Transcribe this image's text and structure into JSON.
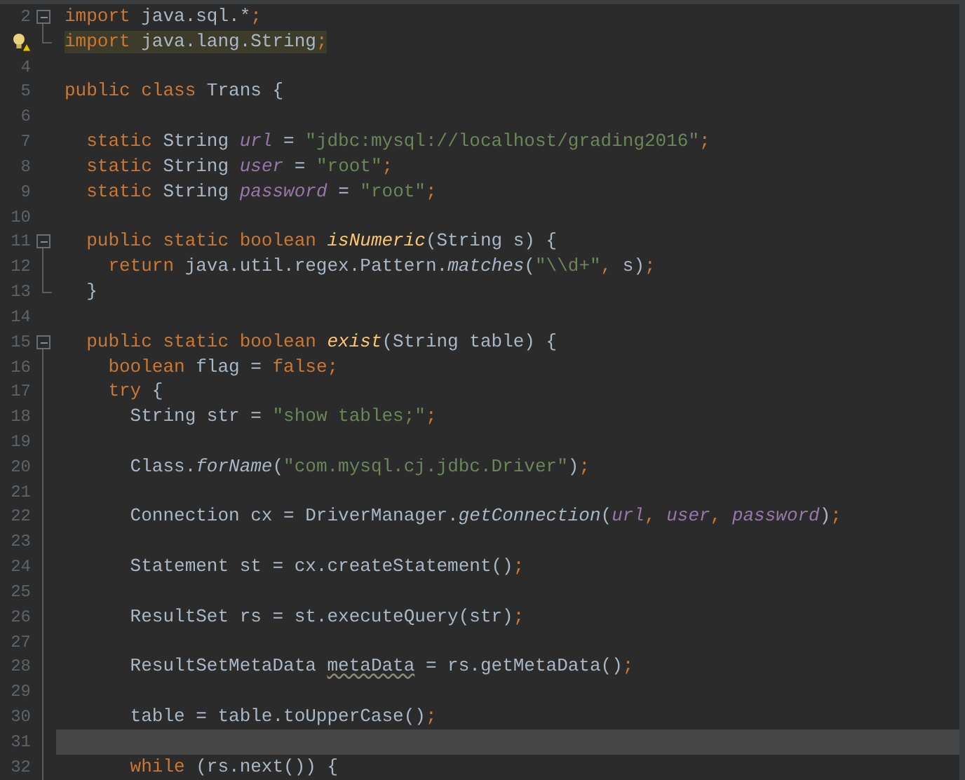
{
  "lines": [
    {
      "number": "2",
      "fold_marker": {
        "kind": "start"
      },
      "current": false,
      "warning": false,
      "tokens": [
        {
          "text": "import",
          "kind": "kw"
        },
        {
          "text": " java.sql.*",
          "kind": "plain"
        },
        {
          "text": ";",
          "kind": "punct"
        }
      ]
    },
    {
      "fold_marker": {
        "kind": "end"
      },
      "current": false,
      "warning": true,
      "tokens": [
        {
          "text": "import",
          "kind": "kw"
        },
        {
          "text": " java.lang.String",
          "kind": "plain"
        },
        {
          "text": ";",
          "kind": "punct"
        }
      ]
    },
    {
      "number": "4",
      "current": false,
      "warning": false
    },
    {
      "number": "5",
      "current": false,
      "warning": false,
      "tokens": [
        {
          "text": "public class",
          "kind": "kw"
        },
        {
          "text": " Trans {",
          "kind": "plain"
        }
      ]
    },
    {
      "number": "6",
      "current": false,
      "warning": false
    },
    {
      "number": "7",
      "current": false,
      "warning": false,
      "tokens": [
        {
          "text": "  static",
          "kind": "kw"
        },
        {
          "text": " String ",
          "kind": "plain"
        },
        {
          "text": "url",
          "kind": "field"
        },
        {
          "text": " = ",
          "kind": "plain"
        },
        {
          "text": "\"jdbc:mysql://localhost/grading2016\"",
          "kind": "str"
        },
        {
          "text": ";",
          "kind": "punct"
        }
      ]
    },
    {
      "number": "8",
      "current": false,
      "warning": false,
      "tokens": [
        {
          "text": "  static",
          "kind": "kw"
        },
        {
          "text": " String ",
          "kind": "plain"
        },
        {
          "text": "user",
          "kind": "field"
        },
        {
          "text": " = ",
          "kind": "plain"
        },
        {
          "text": "\"root\"",
          "kind": "str"
        },
        {
          "text": ";",
          "kind": "punct"
        }
      ]
    },
    {
      "number": "9",
      "current": false,
      "warning": false,
      "tokens": [
        {
          "text": "  static",
          "kind": "kw"
        },
        {
          "text": " String ",
          "kind": "plain"
        },
        {
          "text": "password",
          "kind": "field"
        },
        {
          "text": " = ",
          "kind": "plain"
        },
        {
          "text": "\"root\"",
          "kind": "str"
        },
        {
          "text": ";",
          "kind": "punct"
        }
      ]
    },
    {
      "number": "10",
      "current": false,
      "warning": false
    },
    {
      "number": "11",
      "fold_marker": {
        "kind": "start"
      },
      "current": false,
      "warning": false,
      "tokens": [
        {
          "text": "  public static boolean",
          "kind": "kw"
        },
        {
          "text": " isNumeric",
          "kind": "method"
        },
        {
          "text": "(String s) {",
          "kind": "plain"
        }
      ]
    },
    {
      "number": "12",
      "fold_marker": {
        "kind": "line"
      },
      "current": false,
      "warning": false,
      "tokens": [
        {
          "text": "    return",
          "kind": "kw"
        },
        {
          "text": " java.util.regex.Pattern.",
          "kind": "plain"
        },
        {
          "text": "matches",
          "kind": "call"
        },
        {
          "text": "(",
          "kind": "plain"
        },
        {
          "text": "\"\\\\d+\"",
          "kind": "str"
        },
        {
          "text": ", ",
          "kind": "punct"
        },
        {
          "text": "s)",
          "kind": "plain"
        },
        {
          "text": ";",
          "kind": "punct"
        }
      ]
    },
    {
      "number": "13",
      "fold_marker": {
        "kind": "end"
      },
      "current": false,
      "warning": false,
      "tokens": [
        {
          "text": "  }",
          "kind": "plain"
        }
      ]
    },
    {
      "number": "14",
      "current": false,
      "warning": false
    },
    {
      "number": "15",
      "fold_marker": {
        "kind": "start"
      },
      "current": false,
      "warning": false,
      "tokens": [
        {
          "text": "  public static boolean",
          "kind": "kw"
        },
        {
          "text": " exist",
          "kind": "method"
        },
        {
          "text": "(String table) {",
          "kind": "plain"
        }
      ]
    },
    {
      "number": "16",
      "fold_marker": {
        "kind": "line"
      },
      "current": false,
      "warning": false,
      "tokens": [
        {
          "text": "    boolean",
          "kind": "kw"
        },
        {
          "text": " flag = ",
          "kind": "plain"
        },
        {
          "text": "false",
          "kind": "kw"
        },
        {
          "text": ";",
          "kind": "punct"
        }
      ]
    },
    {
      "number": "17",
      "fold_marker": {
        "kind": "line"
      },
      "current": false,
      "warning": false,
      "tokens": [
        {
          "text": "    try",
          "kind": "kw"
        },
        {
          "text": " {",
          "kind": "plain"
        }
      ]
    },
    {
      "number": "18",
      "fold_marker": {
        "kind": "line"
      },
      "current": false,
      "warning": false,
      "tokens": [
        {
          "text": "      String str = ",
          "kind": "plain"
        },
        {
          "text": "\"show tables;\"",
          "kind": "str"
        },
        {
          "text": ";",
          "kind": "punct"
        }
      ]
    },
    {
      "number": "19",
      "fold_marker": {
        "kind": "line"
      },
      "current": false,
      "warning": false
    },
    {
      "number": "20",
      "fold_marker": {
        "kind": "line"
      },
      "current": false,
      "warning": false,
      "tokens": [
        {
          "text": "      Class.",
          "kind": "plain"
        },
        {
          "text": "forName",
          "kind": "call"
        },
        {
          "text": "(",
          "kind": "plain"
        },
        {
          "text": "\"com.mysql.cj.jdbc.Driver\"",
          "kind": "str"
        },
        {
          "text": ")",
          "kind": "plain"
        },
        {
          "text": ";",
          "kind": "punct"
        }
      ]
    },
    {
      "number": "21",
      "fold_marker": {
        "kind": "line"
      },
      "current": false,
      "warning": false
    },
    {
      "number": "22",
      "fold_marker": {
        "kind": "line"
      },
      "current": false,
      "warning": false,
      "tokens": [
        {
          "text": "      Connection cx = DriverManager.",
          "kind": "plain"
        },
        {
          "text": "getConnection",
          "kind": "call"
        },
        {
          "text": "(",
          "kind": "plain"
        },
        {
          "text": "url",
          "kind": "field"
        },
        {
          "text": ", ",
          "kind": "punct"
        },
        {
          "text": "user",
          "kind": "field"
        },
        {
          "text": ", ",
          "kind": "punct"
        },
        {
          "text": "password",
          "kind": "field"
        },
        {
          "text": ")",
          "kind": "plain"
        },
        {
          "text": ";",
          "kind": "punct"
        }
      ]
    },
    {
      "number": "23",
      "fold_marker": {
        "kind": "line"
      },
      "current": false,
      "warning": false
    },
    {
      "number": "24",
      "fold_marker": {
        "kind": "line"
      },
      "current": false,
      "warning": false,
      "tokens": [
        {
          "text": "      Statement st = cx.createStatement()",
          "kind": "plain"
        },
        {
          "text": ";",
          "kind": "punct"
        }
      ]
    },
    {
      "number": "25",
      "fold_marker": {
        "kind": "line"
      },
      "current": false,
      "warning": false
    },
    {
      "number": "26",
      "fold_marker": {
        "kind": "line"
      },
      "current": false,
      "warning": false,
      "tokens": [
        {
          "text": "      ResultSet rs = st.executeQuery(str)",
          "kind": "plain"
        },
        {
          "text": ";",
          "kind": "punct"
        }
      ]
    },
    {
      "number": "27",
      "fold_marker": {
        "kind": "line"
      },
      "current": false,
      "warning": false
    },
    {
      "number": "28",
      "fold_marker": {
        "kind": "line"
      },
      "current": false,
      "warning": false,
      "tokens": [
        {
          "text": "      ResultSetMetaData ",
          "kind": "plain"
        },
        {
          "text": "metaData",
          "kind": "unused"
        },
        {
          "text": " = rs.getMetaData()",
          "kind": "plain"
        },
        {
          "text": ";",
          "kind": "punct"
        }
      ]
    },
    {
      "number": "29",
      "fold_marker": {
        "kind": "line"
      },
      "current": false,
      "warning": false
    },
    {
      "number": "30",
      "fold_marker": {
        "kind": "line"
      },
      "current": false,
      "warning": false,
      "tokens": [
        {
          "text": "      table = table.toUpperCase()",
          "kind": "plain"
        },
        {
          "text": ";",
          "kind": "punct"
        }
      ]
    },
    {
      "number": "31",
      "fold_marker": {
        "kind": "line"
      },
      "current": true,
      "warning": false
    },
    {
      "number": "32",
      "fold_marker": {
        "kind": "line"
      },
      "current": false,
      "warning": false,
      "tokens": [
        {
          "text": "      while",
          "kind": "kw"
        },
        {
          "text": " (rs.next()) {",
          "kind": "plain"
        }
      ]
    }
  ]
}
